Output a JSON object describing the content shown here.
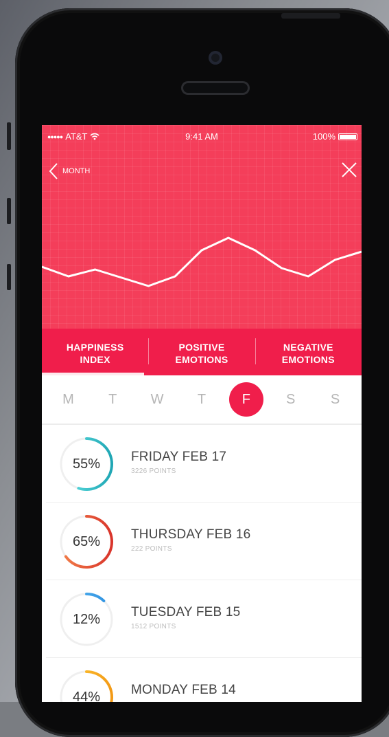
{
  "status_bar": {
    "carrier": "AT&T",
    "time": "9:41 AM",
    "battery": "100%"
  },
  "nav": {
    "back_label": "MONTH"
  },
  "chart_data": {
    "type": "line",
    "x": [
      0,
      1,
      2,
      3,
      4,
      5,
      6,
      7,
      8,
      9,
      10,
      11,
      12
    ],
    "values": [
      45,
      38,
      43,
      37,
      31,
      38,
      57,
      66,
      57,
      44,
      38,
      50,
      56
    ],
    "ylim": [
      0,
      100
    ],
    "grid": true,
    "line_color": "#ffffff"
  },
  "tabs": [
    {
      "line1": "HAPPINESS",
      "line2": "INDEX",
      "active": true
    },
    {
      "line1": "POSITIVE",
      "line2": "EMOTIONS",
      "active": false
    },
    {
      "line1": "NEGATIVE",
      "line2": "EMOTIONS",
      "active": false
    }
  ],
  "days": [
    "M",
    "T",
    "W",
    "T",
    "F",
    "S",
    "S"
  ],
  "selected_day_index": 4,
  "entries": [
    {
      "percent": "55%",
      "value": 0.55,
      "title": "FRIDAY FEB 17",
      "points": "3226 POINTS",
      "color_start": "#63e3e4",
      "color_end": "#1fa6b4"
    },
    {
      "percent": "65%",
      "value": 0.65,
      "title": "THURSDAY FEB 16",
      "points": "222 POINTS",
      "color_start": "#f2804a",
      "color_end": "#d9342b"
    },
    {
      "percent": "12%",
      "value": 0.12,
      "title": "TUESDAY FEB 15",
      "points": "1512 POINTS",
      "color_start": "#5ab9f0",
      "color_end": "#2c8fe0"
    },
    {
      "percent": "44%",
      "value": 0.44,
      "title": "MONDAY FEB 14",
      "points": "",
      "color_start": "#ffce3a",
      "color_end": "#f39a16"
    }
  ],
  "colors": {
    "hero": "#f43e5a",
    "accent": "#f01e4b"
  }
}
